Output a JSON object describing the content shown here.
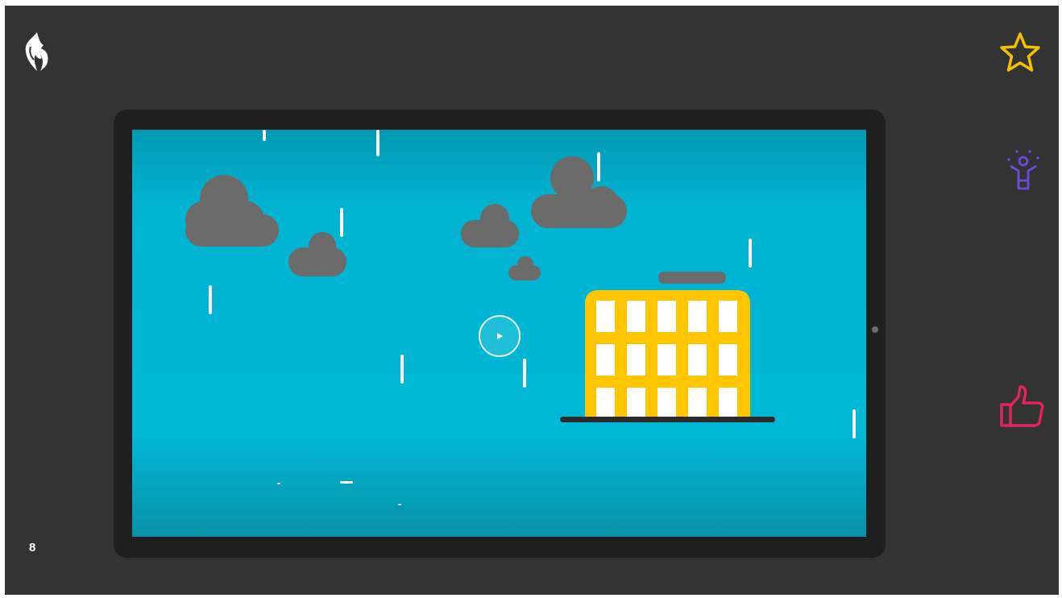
{
  "slide": {
    "page_number": "8",
    "background_color": "#333333"
  },
  "logo": {
    "icon": "stylized-flame-logo-icon",
    "color": "#ffffff"
  },
  "side_icons": [
    {
      "name": "star-icon",
      "color": "#f2c200"
    },
    {
      "name": "person-celebrating-icon",
      "color": "#6a4cd8"
    },
    {
      "name": "thumbs-up-icon",
      "color": "#e0245e"
    }
  ],
  "video": {
    "state": "paused",
    "sky_color": "#00b8d6",
    "cloud_color": "#6b6b6b",
    "building_color": "#ffc600",
    "play_icon": "play-icon"
  }
}
